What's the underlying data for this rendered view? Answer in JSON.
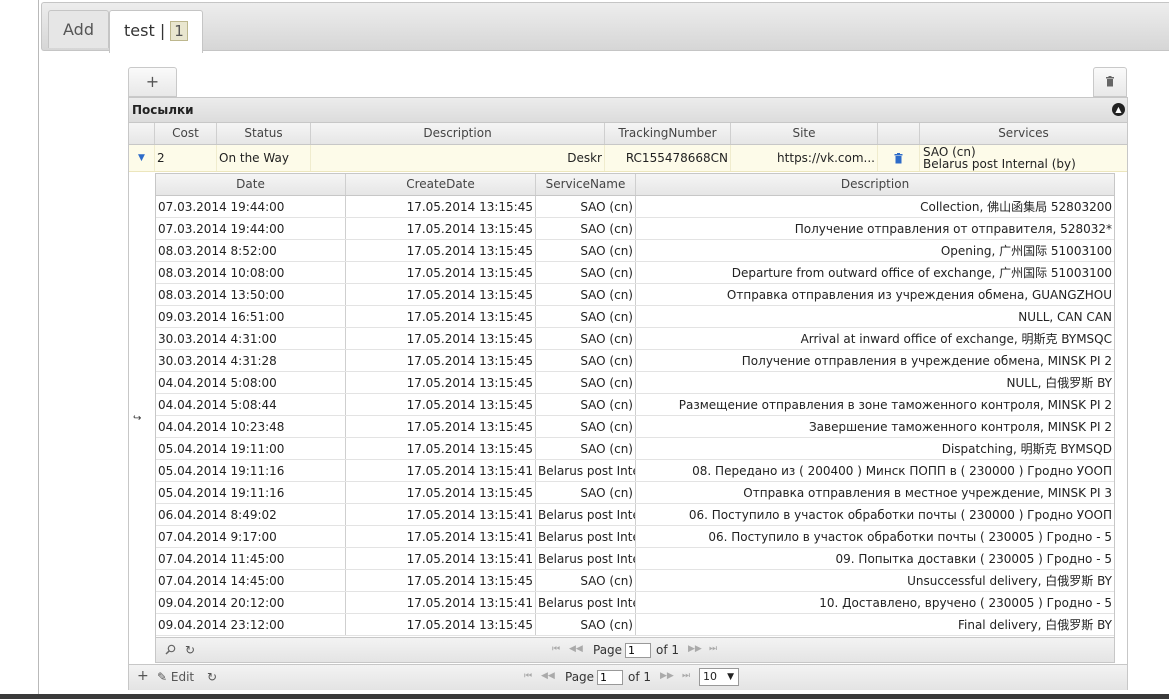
{
  "tabs": [
    {
      "label": "Add"
    },
    {
      "label": "test |",
      "badge": "1"
    }
  ],
  "grid": {
    "caption": "Посылки",
    "columns": [
      "Cost",
      "Status",
      "Description",
      "TrackingNumber",
      "Site",
      "Services"
    ],
    "row": {
      "cost": "2",
      "status": "On the Way",
      "description": "Deskr",
      "tracking": "RC155478668CN",
      "site": "https://vk.com...",
      "services_line1": "SAO (cn)",
      "services_line2": "Belarus post Internal (by)"
    },
    "pager": {
      "page_label": "Page",
      "page_value": "1",
      "of_label": "of 1",
      "page_size": "10"
    },
    "edit_label": "Edit"
  },
  "subgrid": {
    "columns": [
      "Date",
      "CreateDate",
      "ServiceName",
      "Description"
    ],
    "rows": [
      [
        "07.03.2014 19:44:00",
        "17.05.2014 13:15:45",
        "SAO (cn)",
        "Collection, 佛山函集局 52803200"
      ],
      [
        "07.03.2014 19:44:00",
        "17.05.2014 13:15:45",
        "SAO (cn)",
        "Получение отправления от отправителя, 528032*"
      ],
      [
        "08.03.2014 8:52:00",
        "17.05.2014 13:15:45",
        "SAO (cn)",
        "Opening, 广州国际 51003100"
      ],
      [
        "08.03.2014 10:08:00",
        "17.05.2014 13:15:45",
        "SAO (cn)",
        "Departure from outward office of exchange, 广州国际 51003100"
      ],
      [
        "08.03.2014 13:50:00",
        "17.05.2014 13:15:45",
        "SAO (cn)",
        "Отправка отправления из учреждения обмена, GUANGZHOU"
      ],
      [
        "09.03.2014 16:51:00",
        "17.05.2014 13:15:45",
        "SAO (cn)",
        "NULL, CAN CAN"
      ],
      [
        "30.03.2014 4:31:00",
        "17.05.2014 13:15:45",
        "SAO (cn)",
        "Arrival at inward office of exchange, 明斯克 BYMSQC"
      ],
      [
        "30.03.2014 4:31:28",
        "17.05.2014 13:15:45",
        "SAO (cn)",
        "Получение отправления в учреждение обмена, MINSK PI 2"
      ],
      [
        "04.04.2014 5:08:00",
        "17.05.2014 13:15:45",
        "SAO (cn)",
        "NULL, 白俄罗斯 BY"
      ],
      [
        "04.04.2014 5:08:44",
        "17.05.2014 13:15:45",
        "SAO (cn)",
        "Размещение отправления в зоне таможенного контроля, MINSK PI 2"
      ],
      [
        "04.04.2014 10:23:48",
        "17.05.2014 13:15:45",
        "SAO (cn)",
        "Завершение таможенного контроля, MINSK PI 2"
      ],
      [
        "05.04.2014 19:11:00",
        "17.05.2014 13:15:45",
        "SAO (cn)",
        "Dispatching, 明斯克 BYMSQD"
      ],
      [
        "05.04.2014 19:11:16",
        "17.05.2014 13:15:41",
        "Belarus post Inte",
        "08. Передано из ( 200400 ) Минск ПОПП в ( 230000 ) Гродно УООП"
      ],
      [
        "05.04.2014 19:11:16",
        "17.05.2014 13:15:45",
        "SAO (cn)",
        "Отправка отправления в местное учреждение, MINSK PI 3"
      ],
      [
        "06.04.2014 8:49:02",
        "17.05.2014 13:15:41",
        "Belarus post Inte",
        "06. Поступило в участок обработки почты ( 230000 ) Гродно УООП"
      ],
      [
        "07.04.2014 9:17:00",
        "17.05.2014 13:15:41",
        "Belarus post Inte",
        "06. Поступило в участок обработки почты ( 230005 ) Гродно - 5"
      ],
      [
        "07.04.2014 11:45:00",
        "17.05.2014 13:15:41",
        "Belarus post Inte",
        "09. Попытка доставки ( 230005 ) Гродно - 5"
      ],
      [
        "07.04.2014 14:45:00",
        "17.05.2014 13:15:45",
        "SAO (cn)",
        "Unsuccessful delivery, 白俄罗斯 BY"
      ],
      [
        "09.04.2014 20:12:00",
        "17.05.2014 13:15:41",
        "Belarus post Inte",
        "10. Доставлено, вручено ( 230005 ) Гродно - 5"
      ],
      [
        "09.04.2014 23:12:00",
        "17.05.2014 13:15:45",
        "SAO (cn)",
        "Final delivery, 白俄罗斯 BY"
      ]
    ],
    "pager": {
      "page_label": "Page",
      "page_value": "1",
      "of_label": "of 1"
    }
  },
  "icons": {
    "plus": "+",
    "trash": "trash-icon",
    "refresh": "refresh-icon",
    "search": "search-icon",
    "first": "first-page-icon",
    "prev": "prev-page-icon",
    "next": "next-page-icon",
    "last": "last-page-icon"
  }
}
